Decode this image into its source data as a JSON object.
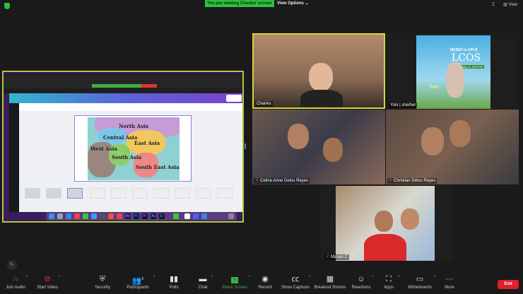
{
  "topbar": {
    "viewing_label": "You are viewing Charles' screen",
    "view_options_label": "View Options",
    "view_label": "View"
  },
  "shared_screen": {
    "slide_labels": [
      "North Asia",
      "Central Asia",
      "East Asia",
      "West Asia",
      "South Asia",
      "South East Asia"
    ],
    "dock_apps": [
      "Ae",
      "Ps",
      "Pr",
      "Au",
      "Lr"
    ]
  },
  "participants": [
    {
      "name": "Charles",
      "active": true
    },
    {
      "name": "Yoni | she/her",
      "muted": false
    },
    {
      "name": "Celine Anne Delos Reyes",
      "muted": true
    },
    {
      "name": "Christian Delos Reyes",
      "muted": true
    },
    {
      "name": "Ma'am C",
      "muted": true
    }
  ],
  "yoni_poster": {
    "line1": "MESEC in UPLB",
    "line2": "LCOS",
    "date": "May 11, 8:00 PM",
    "tag": "Yoni"
  },
  "toolbar": {
    "items": [
      {
        "label": "Join Audio",
        "icon": "headphones-icon"
      },
      {
        "label": "Start Video",
        "icon": "video-off-icon"
      },
      {
        "label": "Security",
        "icon": "shield-icon"
      },
      {
        "label": "Participants",
        "icon": "participants-icon",
        "count": "5"
      },
      {
        "label": "Polls",
        "icon": "polls-icon"
      },
      {
        "label": "Chat",
        "icon": "chat-icon"
      },
      {
        "label": "Share Screen",
        "icon": "share-screen-icon"
      },
      {
        "label": "Record",
        "icon": "record-icon"
      },
      {
        "label": "Show Captions",
        "icon": "captions-icon"
      },
      {
        "label": "Breakout Rooms",
        "icon": "breakout-rooms-icon"
      },
      {
        "label": "Reactions",
        "icon": "reactions-icon"
      },
      {
        "label": "Apps",
        "icon": "apps-icon"
      },
      {
        "label": "Whiteboards",
        "icon": "whiteboard-icon"
      },
      {
        "label": "More",
        "icon": "more-icon"
      }
    ],
    "end_label": "End"
  },
  "colors": {
    "accent_green": "#2fbf3f",
    "end_red": "#d9222a",
    "active_speaker": "#d4d43a"
  }
}
